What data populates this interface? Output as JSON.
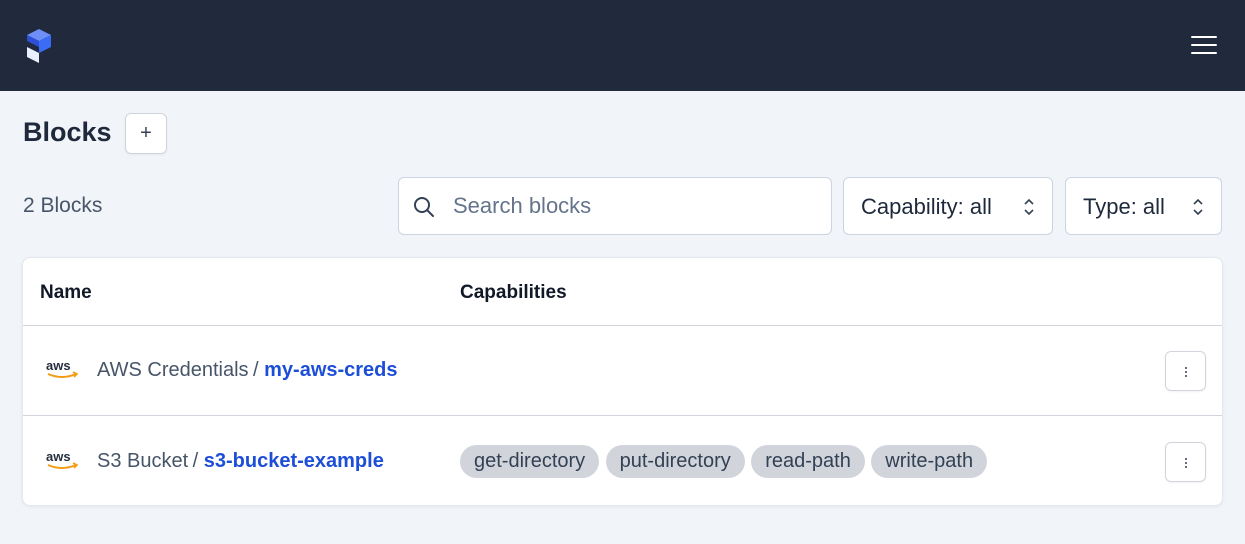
{
  "header": {
    "logo_icon": "prefect-logo",
    "menu_icon": "hamburger-menu-icon"
  },
  "page": {
    "title": "Blocks",
    "add_label": "+"
  },
  "toolbar": {
    "count_text": "2 Blocks",
    "search_placeholder": "Search blocks",
    "search_value": "",
    "capability_select": "Capability: all",
    "type_select": "Type: all"
  },
  "table": {
    "columns": [
      "Name",
      "Capabilities"
    ],
    "rows": [
      {
        "icon": "aws-logo",
        "block_type": "AWS Credentials",
        "separator": "/",
        "block_name": "my-aws-creds",
        "capabilities": []
      },
      {
        "icon": "aws-logo",
        "block_type": "S3 Bucket",
        "separator": "/",
        "block_name": "s3-bucket-example",
        "capabilities": [
          "get-directory",
          "put-directory",
          "read-path",
          "write-path"
        ]
      }
    ]
  },
  "colors": {
    "header_bg": "#212a3c",
    "page_bg": "#f1f4f9",
    "link": "#1d4ed8",
    "tag_bg": "#d1d5db"
  }
}
